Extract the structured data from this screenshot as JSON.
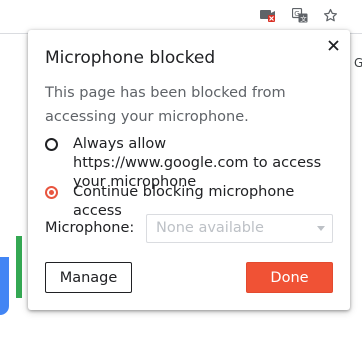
{
  "popup": {
    "title": "Microphone blocked",
    "description": "This page has been blocked from accessing your microphone.",
    "options": [
      {
        "label": "Always allow https://www.google.com to access your microphone",
        "selected": false
      },
      {
        "label": "Continue blocking microphone access",
        "selected": true
      }
    ],
    "microphone_label": "Microphone:",
    "microphone_select_value": "None available",
    "manage_label": "Manage",
    "done_label": "Done",
    "close_symbol": "✕"
  },
  "toolbar": {
    "icons": [
      "camera-blocked-icon",
      "translate-icon",
      "star-icon"
    ]
  },
  "page": {
    "peek_text": "G"
  },
  "colors": {
    "accent": "#e8553f",
    "done_button": "#f05235",
    "google_blue": "#4285f4",
    "google_green": "#34a853",
    "blocked_badge": "#d93025"
  }
}
